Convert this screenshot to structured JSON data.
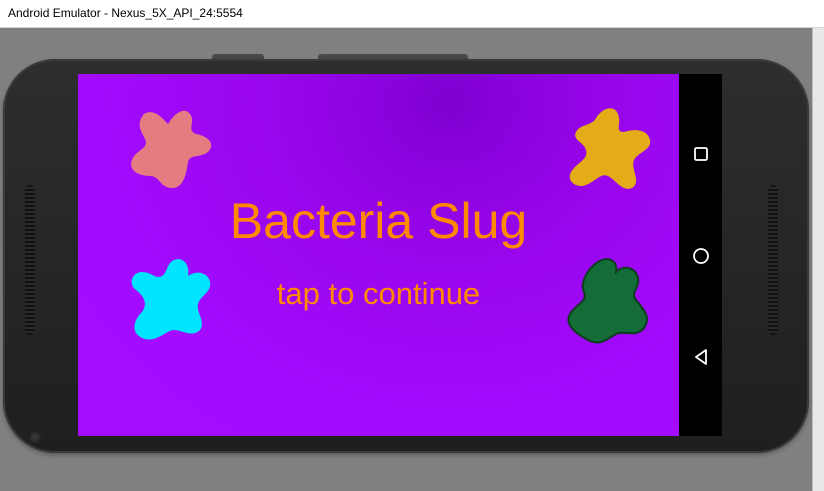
{
  "window": {
    "title": "Android Emulator - Nexus_5X_API_24:5554"
  },
  "game": {
    "title": "Bacteria Slug",
    "subtitle": "tap to continue",
    "background_color": "#a40cff",
    "text_color": "#ff8a00",
    "splats": [
      {
        "name": "pink-splat",
        "color": "#e57c82"
      },
      {
        "name": "yellow-splat",
        "color": "#e4ac16"
      },
      {
        "name": "cyan-splat",
        "color": "#00e5ff"
      },
      {
        "name": "green-splat",
        "color": "#146c36"
      }
    ]
  },
  "navbar": {
    "buttons": [
      {
        "name": "recents-button",
        "icon": "square-icon"
      },
      {
        "name": "home-button",
        "icon": "circle-icon"
      },
      {
        "name": "back-button",
        "icon": "triangle-back-icon"
      }
    ]
  }
}
